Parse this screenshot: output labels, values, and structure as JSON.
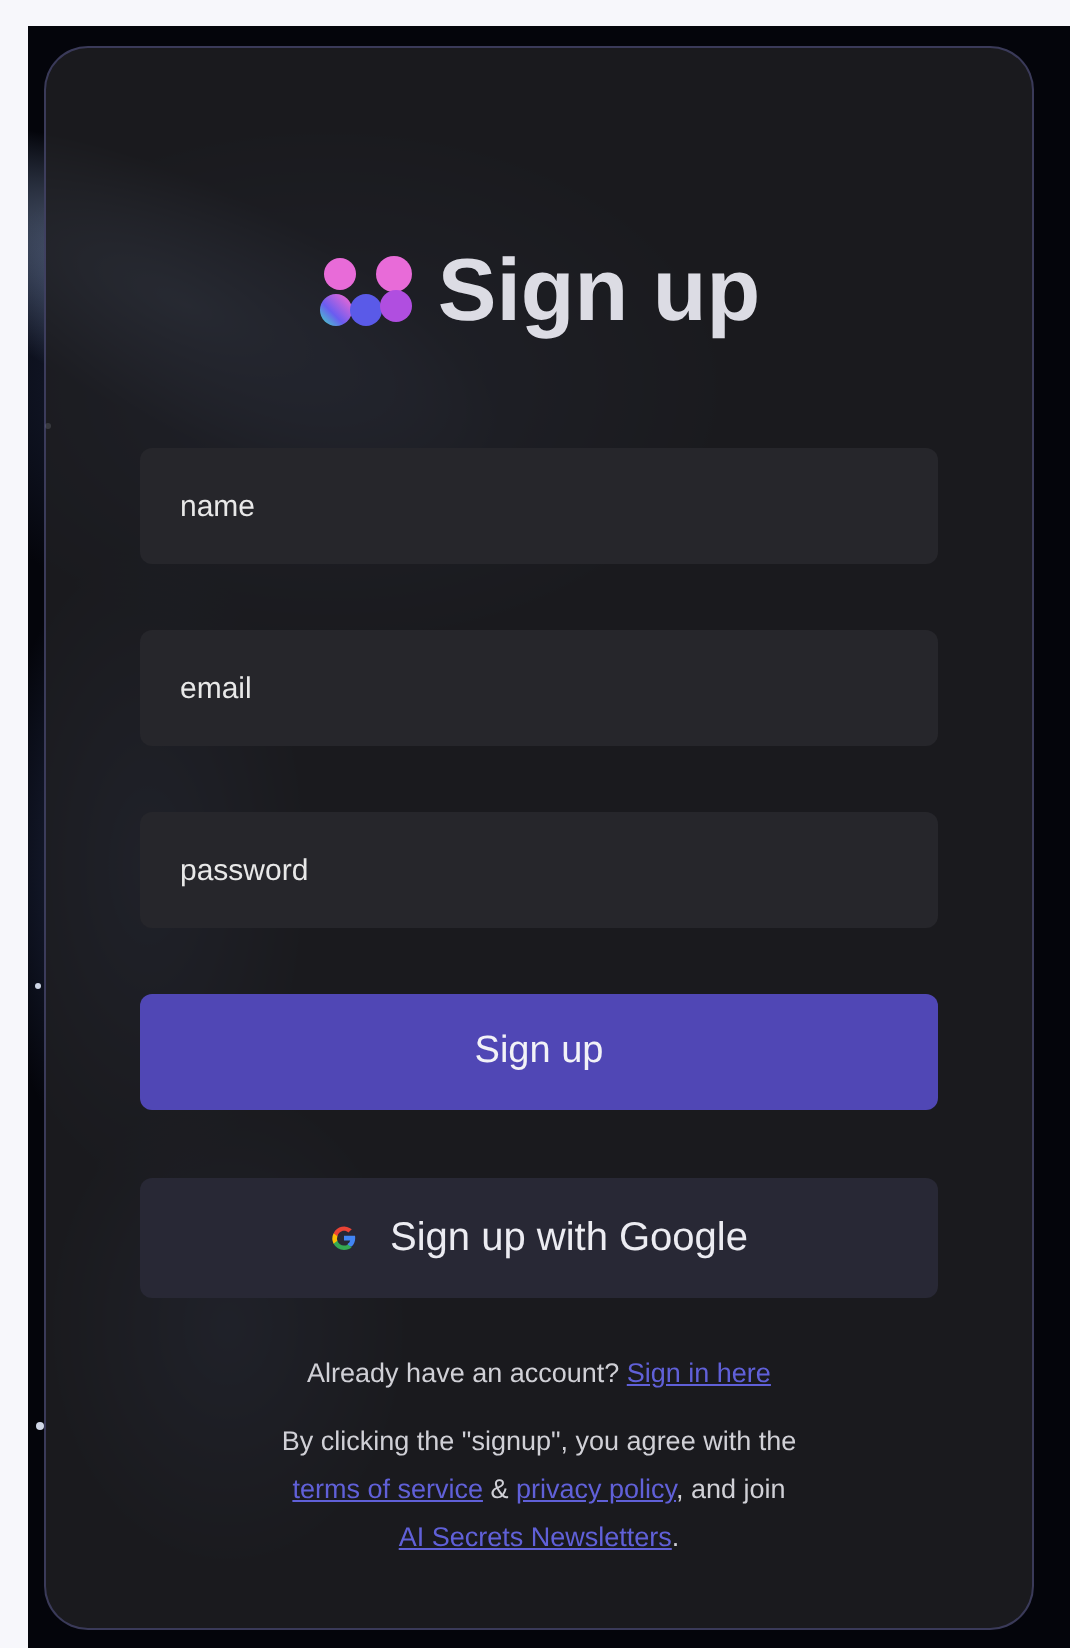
{
  "title": "Sign up",
  "fields": [
    {
      "placeholder": "name"
    },
    {
      "placeholder": "email"
    },
    {
      "placeholder": "password"
    }
  ],
  "submit_button": "Sign up",
  "google_button": "Sign up with Google",
  "signin_prompt": [
    {
      "kind": "text",
      "text": "Already have an account? "
    },
    {
      "kind": "link",
      "text": "Sign in here"
    }
  ],
  "terms": [
    {
      "kind": "text",
      "text": "By clicking the \"signup\", you agree with the "
    },
    {
      "kind": "link",
      "text": "terms of service"
    },
    {
      "kind": "text",
      "text": " & "
    },
    {
      "kind": "link",
      "text": "privacy policy"
    },
    {
      "kind": "text",
      "text": ", and join "
    },
    {
      "kind": "link",
      "text": "AI Secrets Newsletters"
    },
    {
      "kind": "text",
      "text": "."
    }
  ]
}
